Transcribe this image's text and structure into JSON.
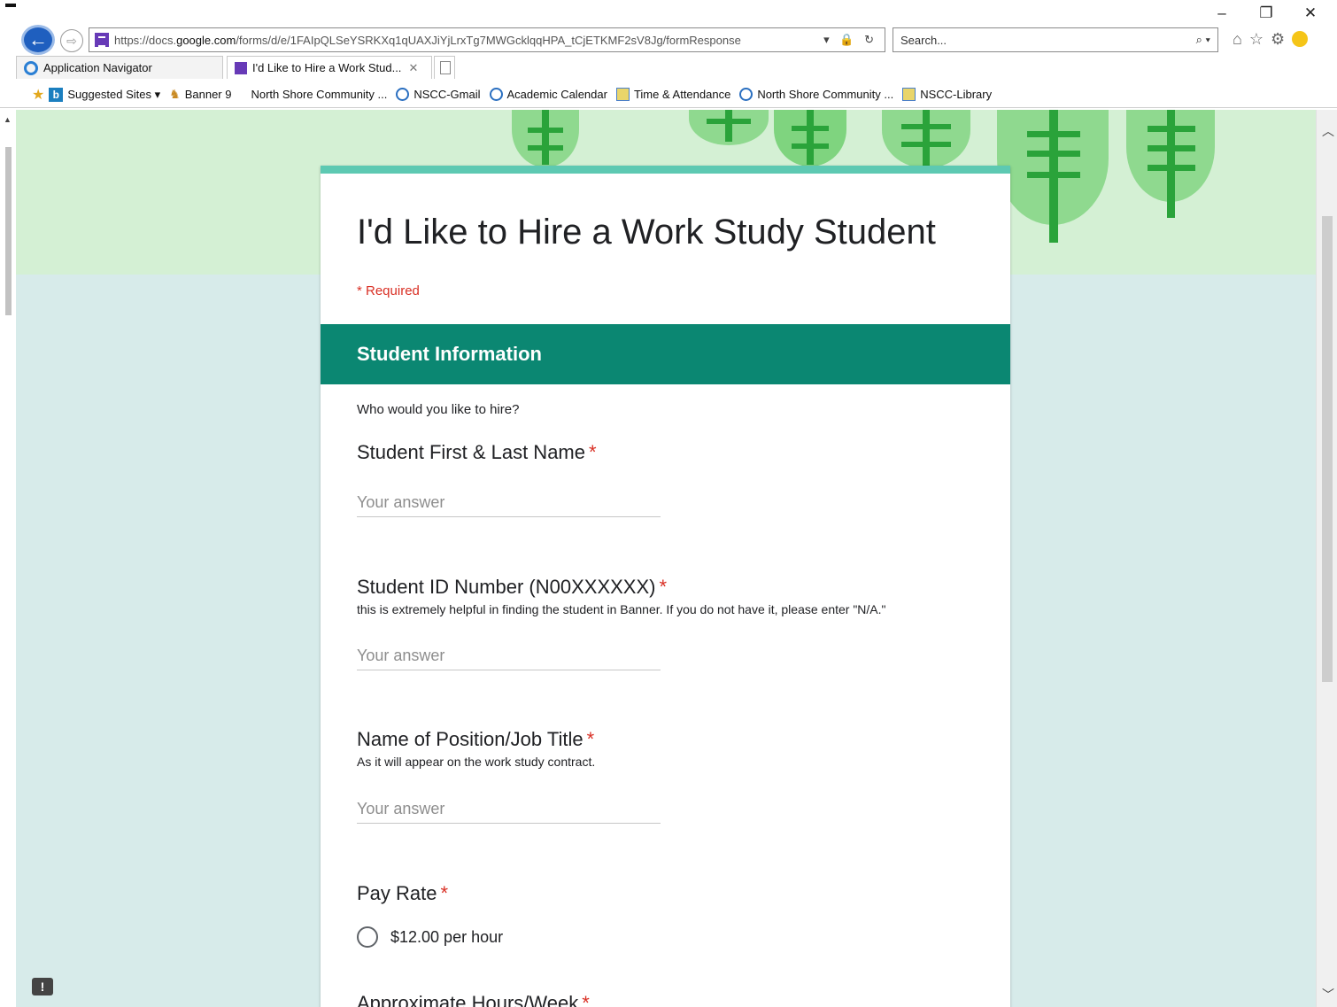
{
  "browser": {
    "window_controls": {
      "minimize": "–",
      "restore": "❐",
      "close": "✕"
    },
    "address": {
      "url_prefix": "https://docs.",
      "url_host": "google.com",
      "url_path": "/forms/d/e/1FAIpQLSeYSRKXq1qUAXJiYjLrxTg7MWGcklqqHPA_tCjETKMF2sV8Jg/formResponse",
      "icons": "▾ 🔒 ↻"
    },
    "search": {
      "placeholder": "Search...",
      "icon": "⌕ ▾"
    },
    "tabs": [
      {
        "label": "Application Navigator",
        "icon": "ie-icon"
      },
      {
        "label": "I'd Like to Hire a Work Stud...",
        "icon": "forms-icon",
        "close": "✕"
      }
    ],
    "favorites": [
      {
        "label": "Suggested Sites ▾",
        "icon": "bing-icon"
      },
      {
        "label": "Banner 9",
        "icon": "banner-icon"
      },
      {
        "label": "North Shore Community ...",
        "icon": "none"
      },
      {
        "label": "NSCC-Gmail",
        "icon": "circle-e-icon"
      },
      {
        "label": "Academic Calendar",
        "icon": "circle-e-icon"
      },
      {
        "label": "Time & Attendance",
        "icon": "ie-page-icon"
      },
      {
        "label": "North Shore Community ...",
        "icon": "circle-e-icon"
      },
      {
        "label": "NSCC-Library",
        "icon": "ie-page-icon"
      }
    ]
  },
  "form": {
    "title": "I'd Like to Hire a Work Study Student",
    "required_note": "* Required",
    "section": {
      "title": "Student Information",
      "description": "Who would you like to hire?"
    },
    "questions": [
      {
        "label": "Student First & Last Name",
        "required": "*",
        "help": "",
        "placeholder": "Your answer"
      },
      {
        "label": "Student ID Number (N00XXXXXX)",
        "required": "*",
        "help": "this is extremely helpful in finding the student in Banner. If you do not have it, please enter \"N/A.\"",
        "placeholder": "Your answer"
      },
      {
        "label": "Name of Position/Job Title",
        "required": "*",
        "help": "As it will appear on the work study contract.",
        "placeholder": "Your answer"
      },
      {
        "label": "Pay Rate",
        "required": "*",
        "options": [
          "$12.00 per hour"
        ]
      },
      {
        "label": "Approximate Hours/Week",
        "required": "*"
      }
    ]
  },
  "colors": {
    "section_header": "#0b8772",
    "card_accent": "#5dc9b2",
    "page_background": "#d7ebea",
    "required": "#d93025"
  }
}
